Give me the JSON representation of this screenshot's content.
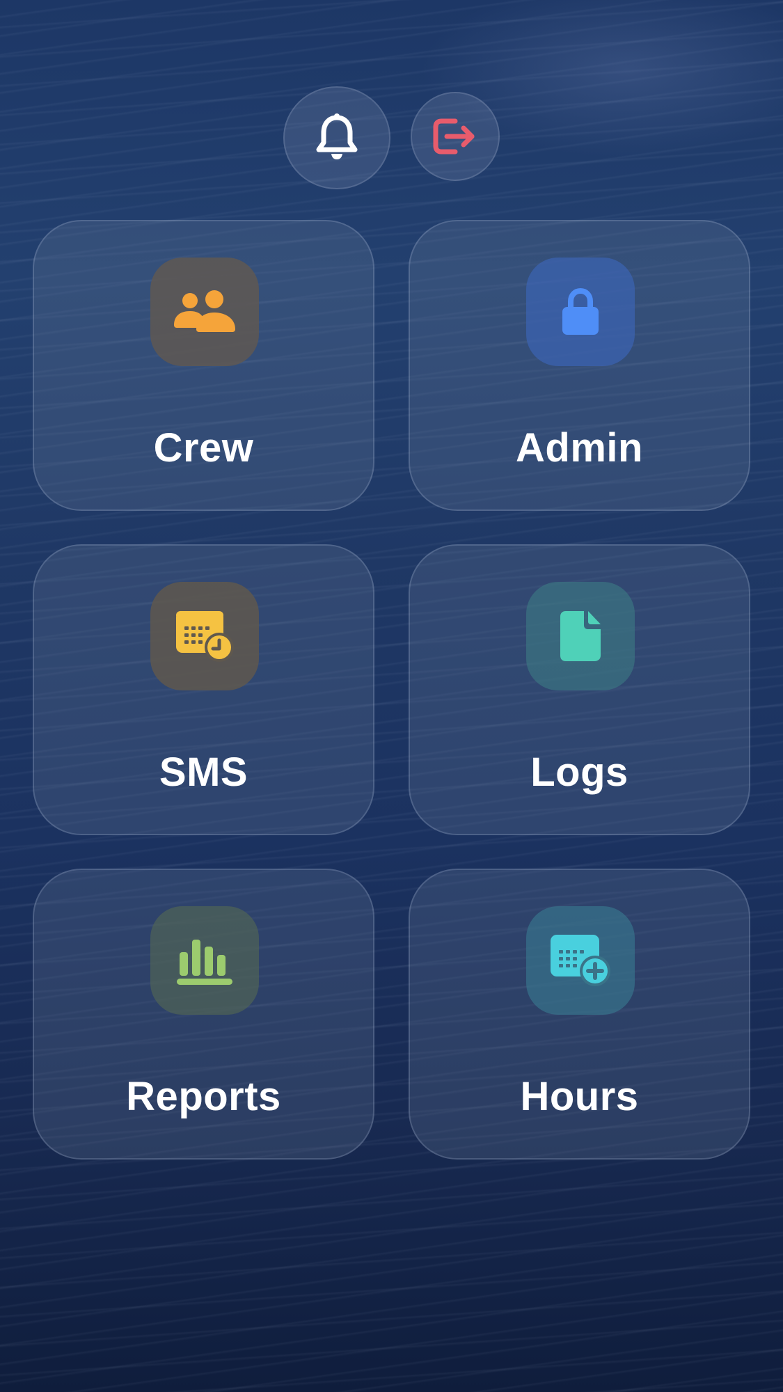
{
  "header": {
    "notifications_icon": "bell-icon",
    "logout_icon": "logout-icon",
    "logout_color": "#e85c6c"
  },
  "tiles": [
    {
      "label": "Crew",
      "icon": "users-icon",
      "color": "#f5a43a"
    },
    {
      "label": "Admin",
      "icon": "lock-icon",
      "color": "#4f8ef7"
    },
    {
      "label": "SMS",
      "icon": "calendar-clock-icon",
      "color": "#f5c242"
    },
    {
      "label": "Logs",
      "icon": "document-icon",
      "color": "#4fd1b8"
    },
    {
      "label": "Reports",
      "icon": "bar-chart-icon",
      "color": "#9ccb6e"
    },
    {
      "label": "Hours",
      "icon": "calendar-plus-icon",
      "color": "#49d0de"
    }
  ]
}
